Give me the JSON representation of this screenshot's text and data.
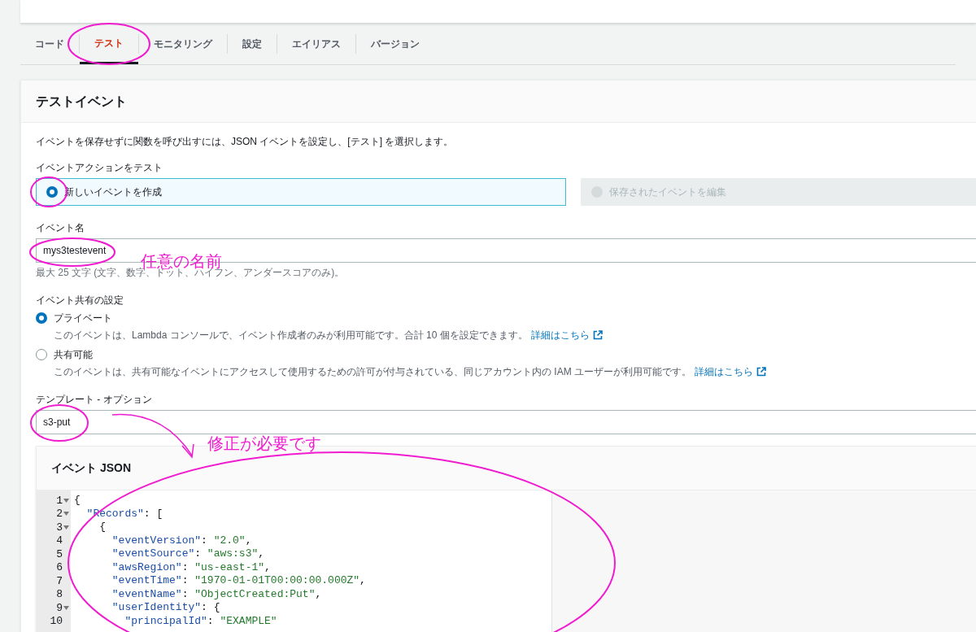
{
  "tabs": [
    {
      "label": "コード",
      "selected": false
    },
    {
      "label": "テスト",
      "selected": true
    },
    {
      "label": "モニタリング",
      "selected": false
    },
    {
      "label": "設定",
      "selected": false
    },
    {
      "label": "エイリアス",
      "selected": false
    },
    {
      "label": "バージョン",
      "selected": false
    }
  ],
  "test_event": {
    "title": "テストイベント",
    "description": "イベントを保存せずに関数を呼び出すには、JSON イベントを設定し、[テスト] を選択します。",
    "action_label": "イベントアクションをテスト",
    "actions": [
      {
        "label": "新しいイベントを作成",
        "selected": true,
        "disabled": false
      },
      {
        "label": "保存されたイベントを編集",
        "selected": false,
        "disabled": true
      }
    ],
    "event_name": {
      "label": "イベント名",
      "value": "mys3testevent",
      "hint": "最大 25 文字 (文字、数字、ドット、ハイフン、アンダースコアのみ)。"
    },
    "sharing": {
      "label": "イベント共有の設定",
      "options": [
        {
          "label": "プライベート",
          "selected": true,
          "description": "このイベントは、Lambda コンソールで、イベント作成者のみが利用可能です。合計 10 個を設定できます。",
          "link": "詳細はこちら"
        },
        {
          "label": "共有可能",
          "selected": false,
          "description": "このイベントは、共有可能なイベントにアクセスして使用するための許可が付与されている、同じアカウント内の IAM ユーザーが利用可能です。",
          "link": "詳細はこちら"
        }
      ]
    },
    "template": {
      "label": "テンプレート - オプション",
      "value": "s3-put"
    },
    "event_json": {
      "title": "イベント JSON",
      "lines": [
        {
          "number": "1",
          "text": "{",
          "fold": true
        },
        {
          "number": "2",
          "text": "  \"Records\": [",
          "fold": true
        },
        {
          "number": "3",
          "text": "    {",
          "fold": true
        },
        {
          "number": "4",
          "text": "      \"eventVersion\": \"2.0\",",
          "fold": false
        },
        {
          "number": "5",
          "text": "      \"eventSource\": \"aws:s3\",",
          "fold": false
        },
        {
          "number": "6",
          "text": "      \"awsRegion\": \"us-east-1\",",
          "fold": false
        },
        {
          "number": "7",
          "text": "      \"eventTime\": \"1970-01-01T00:00:00.000Z\",",
          "fold": false
        },
        {
          "number": "8",
          "text": "      \"eventName\": \"ObjectCreated:Put\",",
          "fold": false
        },
        {
          "number": "9",
          "text": "      \"userIdentity\": {",
          "fold": true
        },
        {
          "number": "10",
          "text": "        \"principalId\": \"EXAMPLE\"",
          "fold": false
        }
      ]
    }
  },
  "annotations": [
    {
      "text": "任意の名前"
    },
    {
      "text": "修正が必要です"
    }
  ]
}
